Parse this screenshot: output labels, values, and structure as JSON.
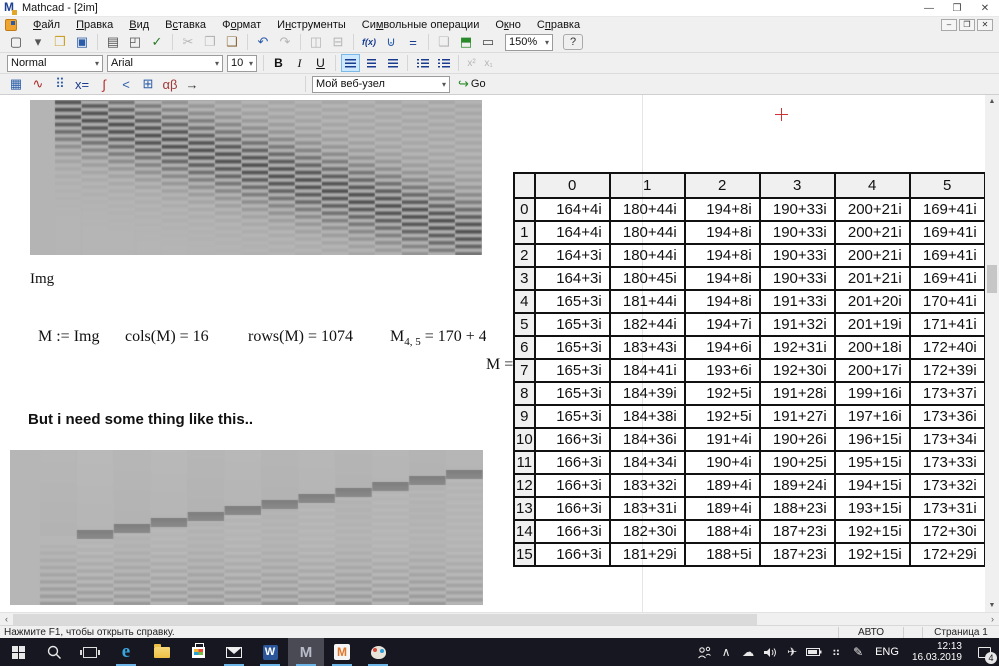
{
  "window": {
    "title": "Mathcad - [2im]",
    "controls": {
      "minimize": "—",
      "restore": "❐",
      "close": "✕"
    },
    "child_controls": {
      "minimize": "–",
      "restore": "❐",
      "close": "✕"
    }
  },
  "menu": {
    "items": [
      {
        "label": "Файл",
        "accel": 0
      },
      {
        "label": "Правка",
        "accel": 0
      },
      {
        "label": "Вид",
        "accel": 0
      },
      {
        "label": "Вставка",
        "accel": 1
      },
      {
        "label": "Формат",
        "accel": 1
      },
      {
        "label": "Инструменты",
        "accel": 1
      },
      {
        "label": "Символьные операции",
        "accel": 2
      },
      {
        "label": "Окно",
        "accel": 1
      },
      {
        "label": "Справка",
        "accel": 1
      }
    ]
  },
  "toolbars": {
    "standard": {
      "zoom": "150%",
      "help": "?",
      "items": [
        {
          "name": "new-icon",
          "glyph": "▢",
          "color": "#444"
        },
        {
          "name": "new-dropdown-arrow-icon",
          "glyph": "▾",
          "color": "#555"
        },
        {
          "name": "open-icon",
          "glyph": "❒",
          "color": "#c9a227"
        },
        {
          "name": "save-icon",
          "glyph": "▣",
          "color": "#2a5caa"
        },
        {
          "sep": true
        },
        {
          "name": "print-icon",
          "glyph": "▤",
          "color": "#555"
        },
        {
          "name": "print-preview-icon",
          "glyph": "◰",
          "color": "#555"
        },
        {
          "name": "spellcheck-icon",
          "glyph": "✓",
          "color": "#2a7a2a"
        },
        {
          "sep": true
        },
        {
          "name": "cut-icon",
          "glyph": "✂",
          "disabled": true
        },
        {
          "name": "copy-icon",
          "glyph": "❐",
          "disabled": true
        },
        {
          "name": "paste-icon",
          "glyph": "❑",
          "color": "#8a6a3a"
        },
        {
          "sep": true
        },
        {
          "name": "undo-icon",
          "glyph": "↶",
          "color": "#2a5caa"
        },
        {
          "name": "redo-icon",
          "glyph": "↷",
          "disabled": true
        },
        {
          "sep": true
        },
        {
          "name": "align-regions-icon",
          "glyph": "◫",
          "disabled": true
        },
        {
          "name": "separate-regions-icon",
          "glyph": "⊟",
          "disabled": true
        },
        {
          "sep": true
        },
        {
          "name": "insert-function-icon",
          "glyph": "f(x)",
          "color": "#1a3c8f",
          "small": true
        },
        {
          "name": "insert-unit-icon",
          "glyph": "⊍",
          "color": "#2a5caa"
        },
        {
          "name": "evaluate-icon",
          "glyph": "=",
          "color": "#1a3c8f"
        },
        {
          "sep": true
        },
        {
          "name": "component-wizard-icon",
          "glyph": "❏",
          "disabled": true
        },
        {
          "name": "insert-component-icon",
          "glyph": "⬒",
          "color": "#2a8a2a"
        },
        {
          "name": "zoom-region-icon",
          "glyph": "▭",
          "color": "#444"
        }
      ]
    },
    "format": {
      "style": "Normal",
      "font": "Arial",
      "size": "10",
      "bold": "B",
      "italic": "I",
      "underline": "U",
      "superscript": "x²",
      "subscript": "x₁"
    },
    "math_palette": {
      "items": [
        {
          "name": "calculator-toolbar-icon",
          "glyph": "▦",
          "color": "#2a5caa"
        },
        {
          "name": "graph-toolbar-icon",
          "glyph": "∿",
          "color": "#b02a2a"
        },
        {
          "name": "matrix-toolbar-icon",
          "glyph": "⠿",
          "color": "#2a5caa"
        },
        {
          "name": "evaluation-toolbar-icon",
          "glyph": "x=",
          "color": "#1a3c8f"
        },
        {
          "name": "calculus-toolbar-icon",
          "glyph": "∫",
          "color": "#b02a2a"
        },
        {
          "name": "boolean-toolbar-icon",
          "glyph": "<",
          "color": "#2a5caa"
        },
        {
          "name": "programming-toolbar-icon",
          "glyph": "⊞",
          "color": "#2a5caa"
        },
        {
          "name": "greek-toolbar-icon",
          "glyph": "αβ",
          "color": "#a03a3a"
        },
        {
          "name": "symbolic-toolbar-icon",
          "glyph": "→",
          "color": "#333"
        }
      ]
    },
    "resources": {
      "url": "Мой веб-узел",
      "go": "Go"
    }
  },
  "document": {
    "img_label": "Img",
    "expr_m_def": "M := Img",
    "expr_cols": "cols(M) = 16",
    "expr_rows": "rows(M) = 1074",
    "expr_m45": {
      "base": "M",
      "sub": "4, 5",
      "rest": " = 170 + 4"
    },
    "expr_m_eq": "M =",
    "note": "But i need some thing like this..",
    "table": {
      "col_headers": [
        "0",
        "1",
        "2",
        "3",
        "4",
        "5"
      ],
      "row_headers": [
        "0",
        "1",
        "2",
        "3",
        "4",
        "5",
        "6",
        "7",
        "8",
        "9",
        "10",
        "11",
        "12",
        "13",
        "14",
        "15"
      ],
      "values": [
        [
          "164+4i",
          "180+44i",
          "194+8i",
          "190+33i",
          "200+21i",
          "169+41i"
        ],
        [
          "164+4i",
          "180+44i",
          "194+8i",
          "190+33i",
          "200+21i",
          "169+41i"
        ],
        [
          "164+3i",
          "180+44i",
          "194+8i",
          "190+33i",
          "200+21i",
          "169+41i"
        ],
        [
          "164+3i",
          "180+45i",
          "194+8i",
          "190+33i",
          "201+21i",
          "169+41i"
        ],
        [
          "165+3i",
          "181+44i",
          "194+8i",
          "191+33i",
          "201+20i",
          "170+41i"
        ],
        [
          "165+3i",
          "182+44i",
          "194+7i",
          "191+32i",
          "201+19i",
          "171+41i"
        ],
        [
          "165+3i",
          "183+43i",
          "194+6i",
          "192+31i",
          "200+18i",
          "172+40i"
        ],
        [
          "165+3i",
          "184+41i",
          "193+6i",
          "192+30i",
          "200+17i",
          "172+39i"
        ],
        [
          "165+3i",
          "184+39i",
          "192+5i",
          "191+28i",
          "199+16i",
          "173+37i"
        ],
        [
          "165+3i",
          "184+38i",
          "192+5i",
          "191+27i",
          "197+16i",
          "173+36i"
        ],
        [
          "166+3i",
          "184+36i",
          "191+4i",
          "190+26i",
          "196+15i",
          "173+34i"
        ],
        [
          "166+3i",
          "184+34i",
          "190+4i",
          "190+25i",
          "195+15i",
          "173+33i"
        ],
        [
          "166+3i",
          "183+32i",
          "189+4i",
          "189+24i",
          "194+15i",
          "173+32i"
        ],
        [
          "166+3i",
          "183+31i",
          "189+4i",
          "188+23i",
          "193+15i",
          "173+31i"
        ],
        [
          "166+3i",
          "182+30i",
          "188+4i",
          "187+23i",
          "192+15i",
          "172+30i"
        ],
        [
          "166+3i",
          "181+29i",
          "188+5i",
          "187+23i",
          "192+15i",
          "172+29i"
        ]
      ]
    }
  },
  "status_bar": {
    "hint": "Нажмите F1, чтобы открыть справку.",
    "auto_label": "АВТО",
    "page_label": "Страница 1"
  },
  "taskbar": {
    "language": "ENG",
    "time": "12:13",
    "date": "16.03.2019",
    "notification_count": "4",
    "app_letters": {
      "edge": "e",
      "word": "W",
      "mathcad": "M",
      "mathcad15": "M"
    },
    "tray_glyphs": {
      "chevron": "∧",
      "cloud": "☁",
      "airplane": "✈",
      "grid": "⠶",
      "pen": "✎"
    }
  },
  "colors": {
    "accent_blue": "#6cb5e8",
    "taskbar_bg": "#171721",
    "toolbar_bg": "#f0f0f0",
    "crosshair_red": "#cc3333"
  }
}
